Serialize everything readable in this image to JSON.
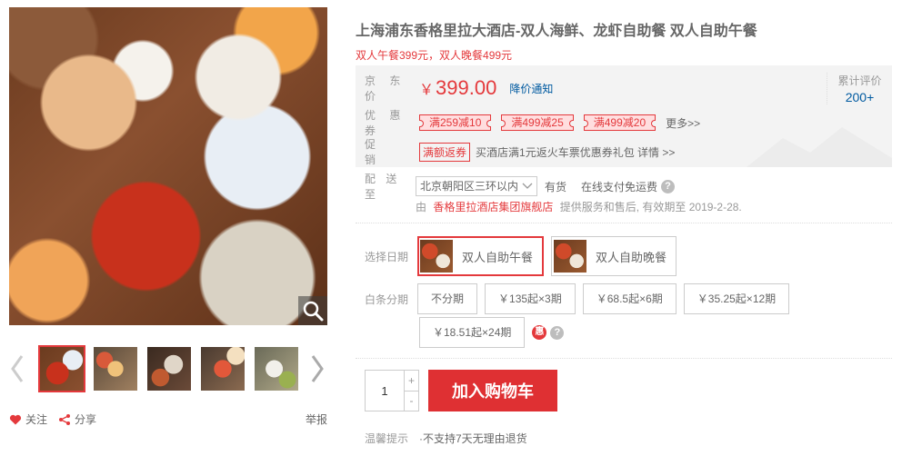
{
  "product": {
    "title": "上海浦东香格里拉大酒店-双人海鲜、龙虾自助餐 双人自助午餐",
    "subtitle": "双人午餐399元，双人晚餐499元"
  },
  "gallery": {
    "report": "举报",
    "follow": "关注",
    "share": "分享"
  },
  "price": {
    "label": "京 东 价",
    "currency": "￥",
    "amount": "399.00",
    "notify": "降价通知"
  },
  "review": {
    "label": "累计评价",
    "count": "200+"
  },
  "coupons": {
    "label": "优 惠 券",
    "items": [
      "满259减10",
      "满499减25",
      "满499减20"
    ],
    "more": "更多>>"
  },
  "promo": {
    "label": "促　　销",
    "tag": "满额返券",
    "text": "买酒店满1元返火车票优惠券礼包 详情 >>"
  },
  "shipping": {
    "label": "配 送 至",
    "address": "北京朝阳区三环以内",
    "stock": "有货",
    "free": "在线支付免运费",
    "seller_prefix": "由",
    "shop": "香格里拉酒店集团旗舰店",
    "seller_suffix": "提供服务和售后, 有效期至 2019-2-28."
  },
  "date": {
    "label": "选择日期",
    "options": [
      "双人自助午餐",
      "双人自助晚餐"
    ],
    "selected": "双人自助午餐"
  },
  "installment": {
    "label": "白条分期",
    "options": [
      "不分期",
      "￥135起×3期",
      "￥68.5起×6期",
      "￥35.25起×12期",
      "￥18.51起×24期"
    ],
    "badge": "惠"
  },
  "cart": {
    "quantity": "1",
    "plus": "+",
    "minus": "-",
    "button": "加入购物车"
  },
  "tips": {
    "label": "温馨提示",
    "text": "·不支持7天无理由退货"
  },
  "colors": {
    "accent": "#e4393c",
    "link": "#005aa0",
    "price_bg": "#f3f3f3"
  },
  "icons": [
    "zoom-icon",
    "prev-arrow-icon",
    "next-arrow-icon",
    "heart-icon",
    "share-icon",
    "dropdown-arrow-icon",
    "help-icon"
  ]
}
